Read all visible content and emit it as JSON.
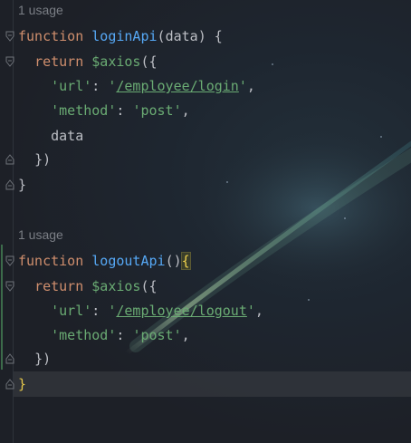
{
  "blocks": [
    {
      "usage": "1 usage",
      "signature": {
        "keyword": "function",
        "name": "loginApi",
        "open": "(",
        "param": "data",
        "close": ") {"
      },
      "return_kw": "return",
      "call": "$axios",
      "call_open": "({",
      "url_key": "'url'",
      "url_colon": ": ",
      "url_quote_open": "'",
      "url_value": "/employee/login",
      "url_quote_close": "'",
      "url_comma": ",",
      "method_key": "'method'",
      "method_colon": ": ",
      "method_value": "'post'",
      "method_comma": ",",
      "extra_line": "data",
      "call_close": "})",
      "fn_close": "}"
    },
    {
      "usage": "1 usage",
      "signature": {
        "keyword": "function",
        "name": "logoutApi",
        "open": "()",
        "param": "",
        "close": "{"
      },
      "return_kw": "return",
      "call": "$axios",
      "call_open": "({",
      "url_key": "'url'",
      "url_colon": ": ",
      "url_quote_open": "'",
      "url_value": "/employee/logout",
      "url_quote_close": "'",
      "url_comma": ",",
      "method_key": "'method'",
      "method_colon": ": ",
      "method_value": "'post'",
      "method_comma": ",",
      "call_close": "})",
      "fn_close": "}"
    }
  ],
  "colors": {
    "keyword": "#cf8e6d",
    "function_name": "#56a8f5",
    "string": "#6aab73",
    "plain": "#bcbec4",
    "brace_match": "#f0d24c",
    "usage_hint": "#7a7e85",
    "background": "#1f2128"
  },
  "icons": {
    "fold_open": "fold-open-icon",
    "fold_end": "fold-end-icon"
  }
}
